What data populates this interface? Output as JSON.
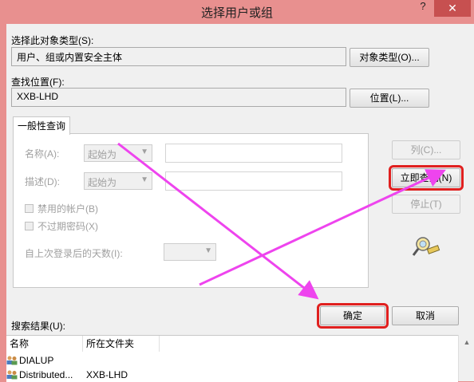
{
  "window": {
    "title": "选择用户或组",
    "help": "?",
    "close": "✕"
  },
  "object_type": {
    "label": "选择此对象类型(S):",
    "value": "用户、组或内置安全主体",
    "button": "对象类型(O)..."
  },
  "location": {
    "label": "查找位置(F):",
    "value": "XXB-LHD",
    "button": "位置(L)..."
  },
  "query": {
    "tab": "一般性查询",
    "name_label": "名称(A):",
    "name_op": "起始为",
    "desc_label": "描述(D):",
    "desc_op": "起始为",
    "disabled_accounts": "禁用的帐户(B)",
    "non_expiring_pw": "不过期密码(X)",
    "days_since_login": "自上次登录后的天数(I):"
  },
  "side_buttons": {
    "columns": "列(C)...",
    "find_now": "立即查找(N)",
    "stop": "停止(T)"
  },
  "actions": {
    "ok": "确定",
    "cancel": "取消"
  },
  "results": {
    "label": "搜索结果(U):",
    "columns": [
      "名称",
      "所在文件夹"
    ],
    "rows": [
      {
        "name": "DIALUP",
        "folder": ""
      },
      {
        "name": "Distributed...",
        "folder": "XXB-LHD"
      }
    ]
  },
  "colors": {
    "highlight": "#e0201f",
    "arrow": "#ee44ee",
    "titlebar": "#e8908f"
  }
}
